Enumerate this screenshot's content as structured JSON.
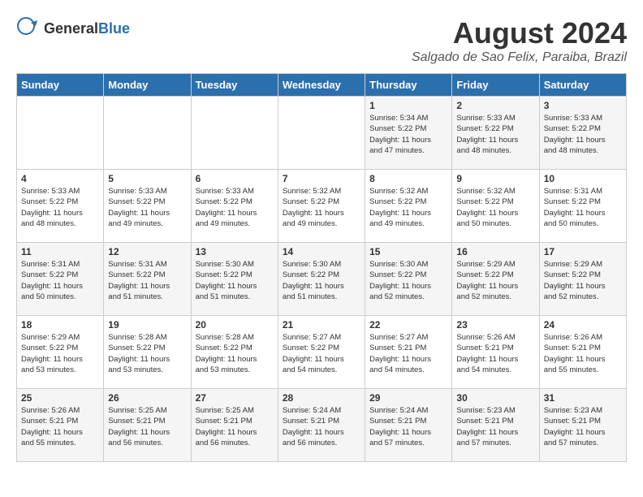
{
  "header": {
    "logo_general": "General",
    "logo_blue": "Blue",
    "month_year": "August 2024",
    "location": "Salgado de Sao Felix, Paraiba, Brazil"
  },
  "days_of_week": [
    "Sunday",
    "Monday",
    "Tuesday",
    "Wednesday",
    "Thursday",
    "Friday",
    "Saturday"
  ],
  "weeks": [
    [
      {
        "day": "",
        "info": ""
      },
      {
        "day": "",
        "info": ""
      },
      {
        "day": "",
        "info": ""
      },
      {
        "day": "",
        "info": ""
      },
      {
        "day": "1",
        "info": "Sunrise: 5:34 AM\nSunset: 5:22 PM\nDaylight: 11 hours\nand 47 minutes."
      },
      {
        "day": "2",
        "info": "Sunrise: 5:33 AM\nSunset: 5:22 PM\nDaylight: 11 hours\nand 48 minutes."
      },
      {
        "day": "3",
        "info": "Sunrise: 5:33 AM\nSunset: 5:22 PM\nDaylight: 11 hours\nand 48 minutes."
      }
    ],
    [
      {
        "day": "4",
        "info": "Sunrise: 5:33 AM\nSunset: 5:22 PM\nDaylight: 11 hours\nand 48 minutes."
      },
      {
        "day": "5",
        "info": "Sunrise: 5:33 AM\nSunset: 5:22 PM\nDaylight: 11 hours\nand 49 minutes."
      },
      {
        "day": "6",
        "info": "Sunrise: 5:33 AM\nSunset: 5:22 PM\nDaylight: 11 hours\nand 49 minutes."
      },
      {
        "day": "7",
        "info": "Sunrise: 5:32 AM\nSunset: 5:22 PM\nDaylight: 11 hours\nand 49 minutes."
      },
      {
        "day": "8",
        "info": "Sunrise: 5:32 AM\nSunset: 5:22 PM\nDaylight: 11 hours\nand 49 minutes."
      },
      {
        "day": "9",
        "info": "Sunrise: 5:32 AM\nSunset: 5:22 PM\nDaylight: 11 hours\nand 50 minutes."
      },
      {
        "day": "10",
        "info": "Sunrise: 5:31 AM\nSunset: 5:22 PM\nDaylight: 11 hours\nand 50 minutes."
      }
    ],
    [
      {
        "day": "11",
        "info": "Sunrise: 5:31 AM\nSunset: 5:22 PM\nDaylight: 11 hours\nand 50 minutes."
      },
      {
        "day": "12",
        "info": "Sunrise: 5:31 AM\nSunset: 5:22 PM\nDaylight: 11 hours\nand 51 minutes."
      },
      {
        "day": "13",
        "info": "Sunrise: 5:30 AM\nSunset: 5:22 PM\nDaylight: 11 hours\nand 51 minutes."
      },
      {
        "day": "14",
        "info": "Sunrise: 5:30 AM\nSunset: 5:22 PM\nDaylight: 11 hours\nand 51 minutes."
      },
      {
        "day": "15",
        "info": "Sunrise: 5:30 AM\nSunset: 5:22 PM\nDaylight: 11 hours\nand 52 minutes."
      },
      {
        "day": "16",
        "info": "Sunrise: 5:29 AM\nSunset: 5:22 PM\nDaylight: 11 hours\nand 52 minutes."
      },
      {
        "day": "17",
        "info": "Sunrise: 5:29 AM\nSunset: 5:22 PM\nDaylight: 11 hours\nand 52 minutes."
      }
    ],
    [
      {
        "day": "18",
        "info": "Sunrise: 5:29 AM\nSunset: 5:22 PM\nDaylight: 11 hours\nand 53 minutes."
      },
      {
        "day": "19",
        "info": "Sunrise: 5:28 AM\nSunset: 5:22 PM\nDaylight: 11 hours\nand 53 minutes."
      },
      {
        "day": "20",
        "info": "Sunrise: 5:28 AM\nSunset: 5:22 PM\nDaylight: 11 hours\nand 53 minutes."
      },
      {
        "day": "21",
        "info": "Sunrise: 5:27 AM\nSunset: 5:22 PM\nDaylight: 11 hours\nand 54 minutes."
      },
      {
        "day": "22",
        "info": "Sunrise: 5:27 AM\nSunset: 5:21 PM\nDaylight: 11 hours\nand 54 minutes."
      },
      {
        "day": "23",
        "info": "Sunrise: 5:26 AM\nSunset: 5:21 PM\nDaylight: 11 hours\nand 54 minutes."
      },
      {
        "day": "24",
        "info": "Sunrise: 5:26 AM\nSunset: 5:21 PM\nDaylight: 11 hours\nand 55 minutes."
      }
    ],
    [
      {
        "day": "25",
        "info": "Sunrise: 5:26 AM\nSunset: 5:21 PM\nDaylight: 11 hours\nand 55 minutes."
      },
      {
        "day": "26",
        "info": "Sunrise: 5:25 AM\nSunset: 5:21 PM\nDaylight: 11 hours\nand 56 minutes."
      },
      {
        "day": "27",
        "info": "Sunrise: 5:25 AM\nSunset: 5:21 PM\nDaylight: 11 hours\nand 56 minutes."
      },
      {
        "day": "28",
        "info": "Sunrise: 5:24 AM\nSunset: 5:21 PM\nDaylight: 11 hours\nand 56 minutes."
      },
      {
        "day": "29",
        "info": "Sunrise: 5:24 AM\nSunset: 5:21 PM\nDaylight: 11 hours\nand 57 minutes."
      },
      {
        "day": "30",
        "info": "Sunrise: 5:23 AM\nSunset: 5:21 PM\nDaylight: 11 hours\nand 57 minutes."
      },
      {
        "day": "31",
        "info": "Sunrise: 5:23 AM\nSunset: 5:21 PM\nDaylight: 11 hours\nand 57 minutes."
      }
    ]
  ]
}
